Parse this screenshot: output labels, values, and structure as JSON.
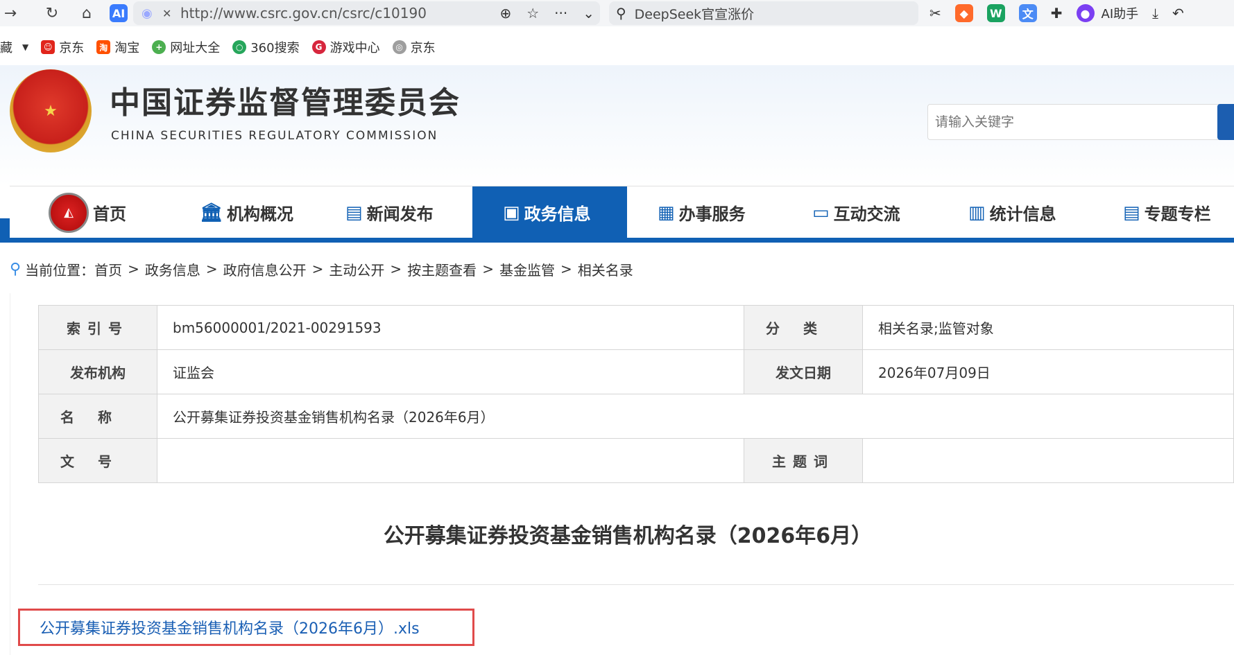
{
  "browser": {
    "url": "http://www.csrc.gov.cn/csrc/c10190",
    "search_text": "DeepSeek官宣涨价",
    "ai_label": "AI助手"
  },
  "bookmarks": [
    {
      "label": "藏"
    },
    {
      "label": "京东",
      "color": "#e1251b"
    },
    {
      "label": "淘宝",
      "color": "#ff5000"
    },
    {
      "label": "网址大全",
      "color": "#4caf50"
    },
    {
      "label": "360搜索",
      "color": "#26a65b"
    },
    {
      "label": "游戏中心",
      "color": "#d7263d"
    },
    {
      "label": "京东",
      "color": "#9e9e9e"
    }
  ],
  "site": {
    "title": "中国证券监督管理委员会",
    "subtitle": "CHINA SECURITIES REGULATORY COMMISSION",
    "search_placeholder": "请输入关键字"
  },
  "nav": [
    {
      "label": "首页"
    },
    {
      "label": "机构概况"
    },
    {
      "label": "新闻发布"
    },
    {
      "label": "政务信息"
    },
    {
      "label": "办事服务"
    },
    {
      "label": "互动交流"
    },
    {
      "label": "统计信息"
    },
    {
      "label": "专题专栏"
    }
  ],
  "breadcrumb": {
    "prefix": "当前位置：",
    "items": [
      "首页",
      "政务信息",
      "政府信息公开",
      "主动公开",
      "按主题查看",
      "基金监管",
      "相关名录"
    ],
    "sep": ">"
  },
  "meta": {
    "index_label": "索引号",
    "index_value": "bm56000001/2021-00291593",
    "category_label": "分类",
    "category_value": "相关名录;监管对象",
    "publisher_label": "发布机构",
    "publisher_value": "证监会",
    "date_label": "发文日期",
    "date_value": "2026年07月09日",
    "name_label": "名称",
    "name_value": "公开募集证券投资基金销售机构名录（2026年6月）",
    "docno_label": "文号",
    "docno_value": "",
    "keywords_label": "主题词",
    "keywords_value": ""
  },
  "document": {
    "title": "公开募集证券投资基金销售机构名录（2026年6月）",
    "attachment": "公开募集证券投资基金销售机构名录（2026年6月）.xls"
  },
  "colors": {
    "brand_blue": "#1060b4",
    "highlight_red": "#e04a4a"
  }
}
